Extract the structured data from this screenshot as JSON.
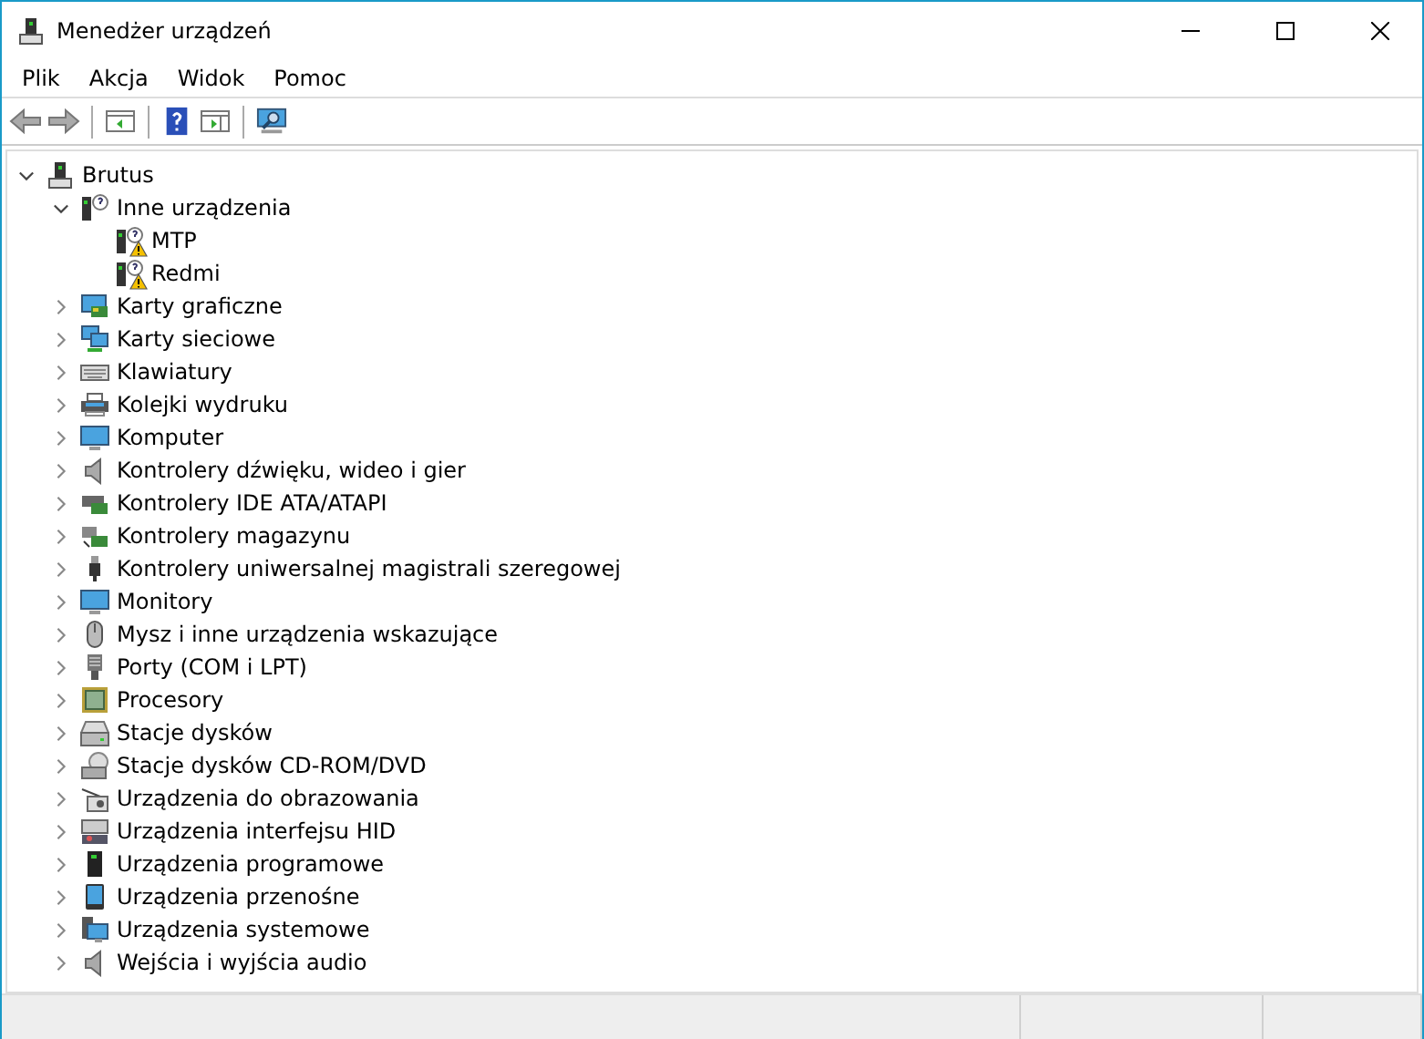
{
  "window": {
    "title": "Menedżer urządzeń"
  },
  "menu": [
    "Plik",
    "Akcja",
    "Widok",
    "Pomoc"
  ],
  "tree": {
    "label": "Brutus",
    "expanded": true,
    "children": [
      {
        "label": "Inne urządzenia",
        "expanded": true,
        "children": [
          {
            "label": "MTP",
            "warning": true
          },
          {
            "label": "Redmi",
            "warning": true
          }
        ]
      },
      {
        "label": "Karty graficzne",
        "expanded": false
      },
      {
        "label": "Karty sieciowe",
        "expanded": false
      },
      {
        "label": "Klawiatury",
        "expanded": false
      },
      {
        "label": "Kolejki wydruku",
        "expanded": false
      },
      {
        "label": "Komputer",
        "expanded": false
      },
      {
        "label": "Kontrolery dźwięku, wideo i gier",
        "expanded": false
      },
      {
        "label": "Kontrolery IDE ATA/ATAPI",
        "expanded": false
      },
      {
        "label": "Kontrolery magazynu",
        "expanded": false
      },
      {
        "label": "Kontrolery uniwersalnej magistrali szeregowej",
        "expanded": false
      },
      {
        "label": "Monitory",
        "expanded": false
      },
      {
        "label": "Mysz i inne urządzenia wskazujące",
        "expanded": false
      },
      {
        "label": "Porty (COM i LPT)",
        "expanded": false
      },
      {
        "label": "Procesory",
        "expanded": false
      },
      {
        "label": "Stacje dysków",
        "expanded": false
      },
      {
        "label": "Stacje dysków CD-ROM/DVD",
        "expanded": false
      },
      {
        "label": "Urządzenia do obrazowania",
        "expanded": false
      },
      {
        "label": "Urządzenia interfejsu HID",
        "expanded": false
      },
      {
        "label": "Urządzenia programowe",
        "expanded": false
      },
      {
        "label": "Urządzenia przenośne",
        "expanded": false
      },
      {
        "label": "Urządzenia systemowe",
        "expanded": false
      },
      {
        "label": "Wejścia i wyjścia audio",
        "expanded": false
      }
    ]
  }
}
